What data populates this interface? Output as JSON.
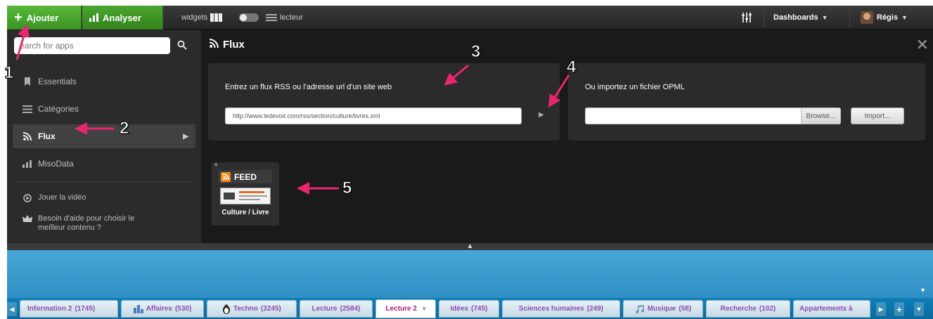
{
  "topbar": {
    "add_label": "Ajouter",
    "analyze_label": "Analyser",
    "widgets_label": "widgets",
    "reader_label": "lecteur",
    "dashboards_label": "Dashboards",
    "user_label": "Régis"
  },
  "sidebar": {
    "search_placeholder": "earch for apps",
    "items": [
      {
        "label": "Essentials",
        "icon": "bookmark-icon"
      },
      {
        "label": "Catégories",
        "icon": "list-icon"
      },
      {
        "label": "Flux",
        "icon": "rss-icon"
      },
      {
        "label": "MisoData",
        "icon": "chart-icon"
      }
    ],
    "video_label": "Jouer la vidéo",
    "help_label_1": "Besoin d'aide pour choisir le",
    "help_label_2": "meilleur contenu ?"
  },
  "panel": {
    "title": "Flux",
    "rss_prompt": "Entrez un flux RSS ou l'adresse url d'un site web",
    "rss_value": "http://www.ledevoir.com/rss/section/culture/livres.xml",
    "opml_prompt": "Ou importez un fichier OPML",
    "browse_label": "Browse...",
    "import_label": "Import...",
    "feed_badge": "FEED",
    "feed_tile_label": "Culture / Livre"
  },
  "annotations": [
    "1",
    "2",
    "3",
    "4",
    "5"
  ],
  "tabs": [
    {
      "label": "Information 2",
      "count": "(1745)",
      "icon": ""
    },
    {
      "label": "Affaires",
      "count": "(530)",
      "icon": "building-icon"
    },
    {
      "label": "Techno",
      "count": "(3245)",
      "icon": "penguin-icon"
    },
    {
      "label": "Lecture",
      "count": "(2584)",
      "icon": ""
    },
    {
      "label": "Lecture 2",
      "count": "",
      "icon": ""
    },
    {
      "label": "Idées",
      "count": "(745)",
      "icon": ""
    },
    {
      "label": "Sciences humaines",
      "count": "(249)",
      "icon": ""
    },
    {
      "label": "Musique",
      "count": "(58)",
      "icon": "music-icon"
    },
    {
      "label": "Recherche",
      "count": "(102)",
      "icon": ""
    },
    {
      "label": "Appartements à",
      "count": "",
      "icon": ""
    }
  ],
  "colors": {
    "accent_green": "#4aa62e",
    "annotation_pink": "#e8266e",
    "tab_text": "#8a4fb0",
    "dashboard_blue": "#3a9bd0"
  }
}
